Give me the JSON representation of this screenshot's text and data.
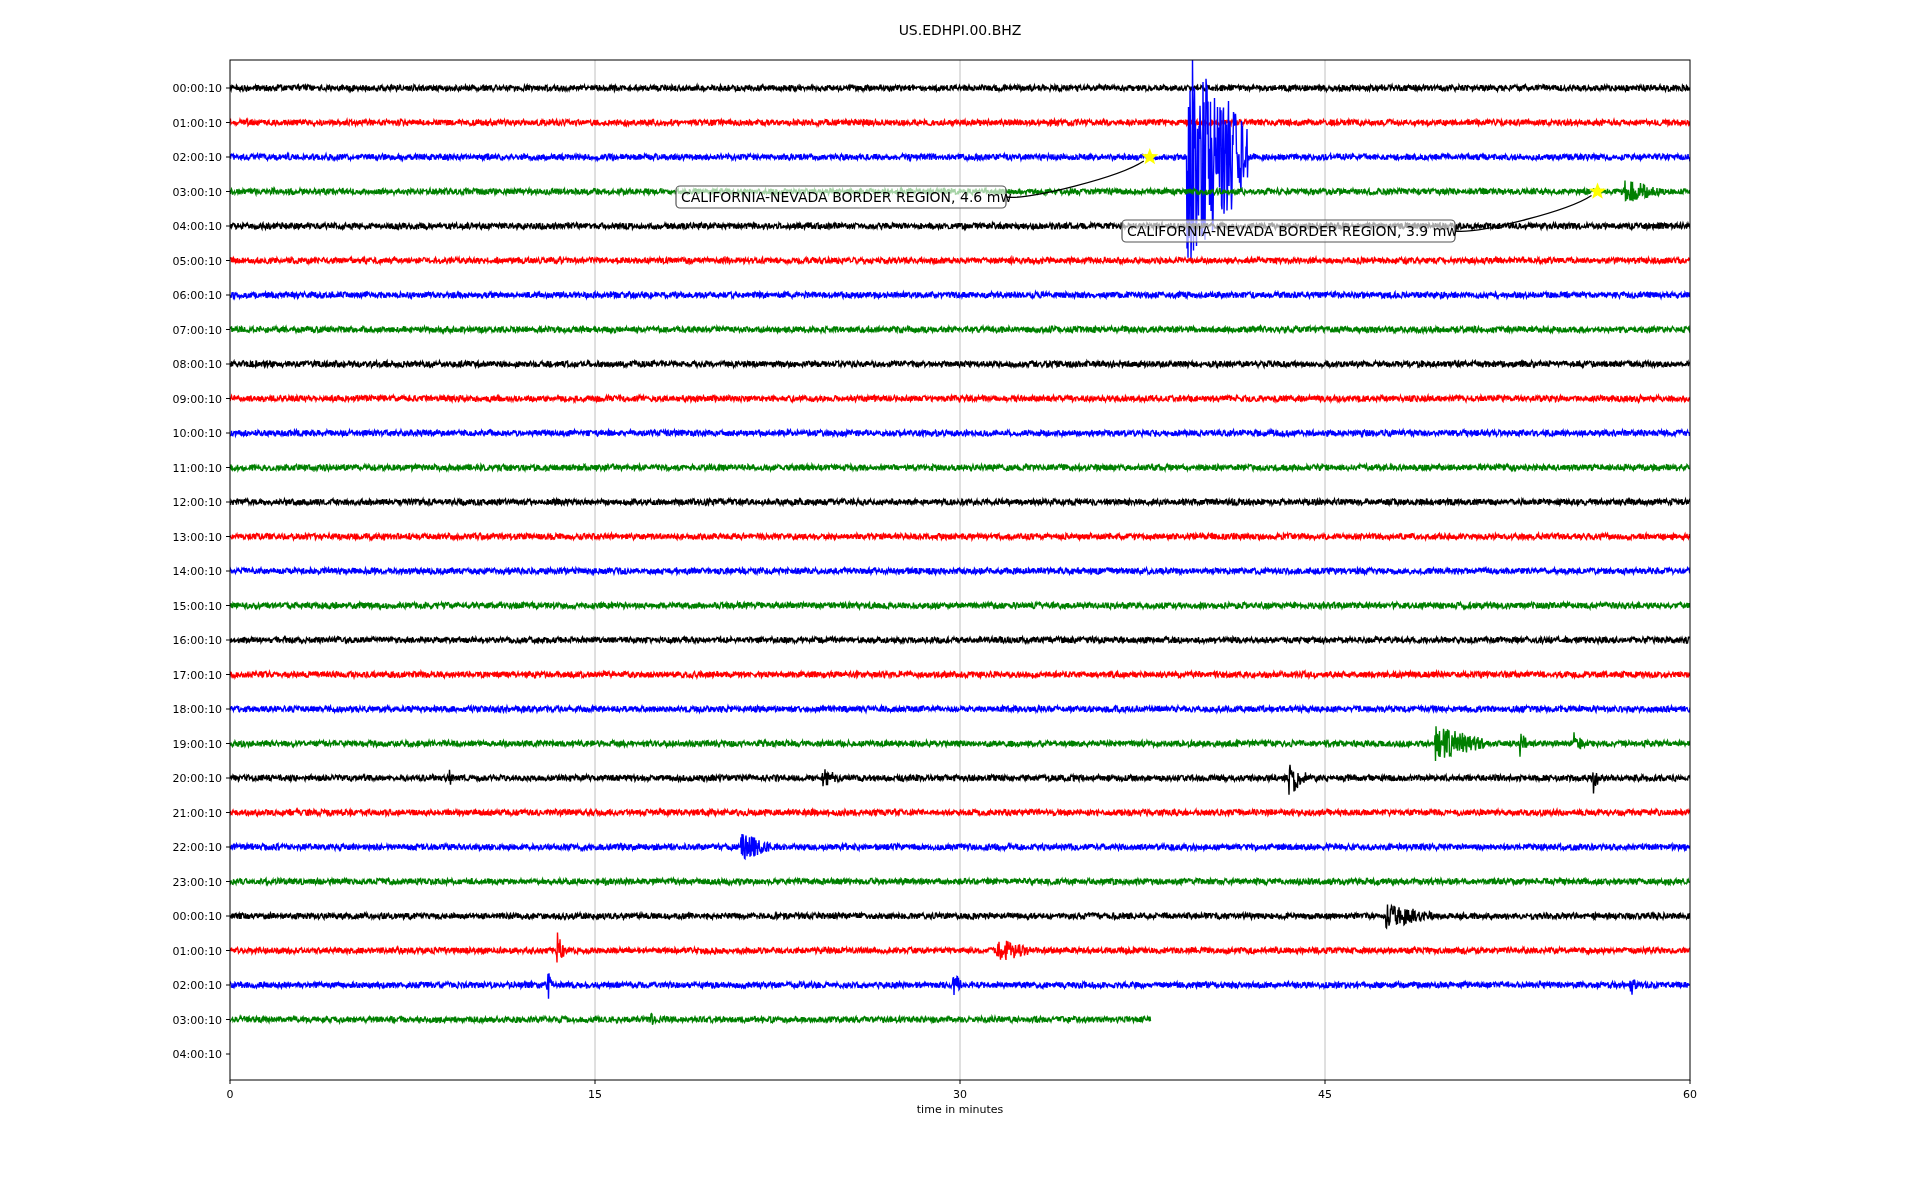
{
  "plot": {
    "title": "US.EDHPI.00.BHZ",
    "xlabel": "time in minutes",
    "xticks": [
      "0",
      "15",
      "30",
      "45",
      "60"
    ],
    "rows": [
      {
        "label": "00:00:10",
        "color": "#000000",
        "level": 1
      },
      {
        "label": "01:00:10",
        "color": "#ff0000",
        "level": 1
      },
      {
        "label": "02:00:10",
        "color": "#0000ff",
        "level": 1,
        "event": "CALIFORNIA-NEVADA BORDER REGION, 4.6 mw"
      },
      {
        "label": "03:00:10",
        "color": "#008000",
        "level": 1,
        "event": "CALIFORNIA-NEVADA BORDER REGION, 3.9 mw"
      },
      {
        "label": "04:00:10",
        "color": "#000000",
        "level": 1
      },
      {
        "label": "05:00:10",
        "color": "#ff0000",
        "level": 1
      },
      {
        "label": "06:00:10",
        "color": "#0000ff",
        "level": 1
      },
      {
        "label": "07:00:10",
        "color": "#008000",
        "level": 1
      },
      {
        "label": "08:00:10",
        "color": "#000000",
        "level": 1
      },
      {
        "label": "09:00:10",
        "color": "#ff0000",
        "level": 1
      },
      {
        "label": "10:00:10",
        "color": "#0000ff",
        "level": 1
      },
      {
        "label": "11:00:10",
        "color": "#008000",
        "level": 1
      },
      {
        "label": "12:00:10",
        "color": "#000000",
        "level": 1
      },
      {
        "label": "13:00:10",
        "color": "#ff0000",
        "level": 1
      },
      {
        "label": "14:00:10",
        "color": "#0000ff",
        "level": 1
      },
      {
        "label": "15:00:10",
        "color": "#008000",
        "level": 1
      },
      {
        "label": "16:00:10",
        "color": "#000000",
        "level": 1
      },
      {
        "label": "17:00:10",
        "color": "#ff0000",
        "level": 1
      },
      {
        "label": "18:00:10",
        "color": "#0000ff",
        "level": 1
      },
      {
        "label": "19:00:10",
        "color": "#008000",
        "level": 1
      },
      {
        "label": "20:00:10",
        "color": "#000000",
        "level": 1
      },
      {
        "label": "21:00:10",
        "color": "#ff0000",
        "level": 1
      },
      {
        "label": "22:00:10",
        "color": "#0000ff",
        "level": 1
      },
      {
        "label": "23:00:10",
        "color": "#008000",
        "level": 1
      },
      {
        "label": "00:00:10",
        "color": "#000000",
        "level": 1
      },
      {
        "label": "01:00:10",
        "color": "#ff0000",
        "level": 1
      },
      {
        "label": "02:00:10",
        "color": "#0000ff",
        "level": 1
      },
      {
        "label": "03:00:10",
        "color": "#008000",
        "level": 0.63
      },
      {
        "label": "04:00:10"
      }
    ]
  }
}
